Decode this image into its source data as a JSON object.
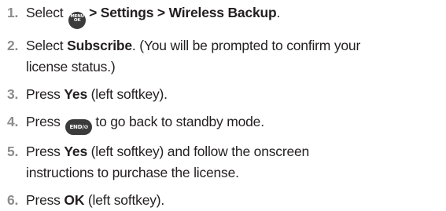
{
  "steps": [
    {
      "number": "1.",
      "parts": [
        {
          "text": "Select",
          "bold": false
        },
        {
          "icon": "menu-ok-key-icon",
          "key_text": [
            "MENU",
            "OK"
          ]
        },
        {
          "text": "> Settings > Wireless Backup",
          "bold": true
        },
        {
          "text": ".",
          "bold": false
        }
      ]
    },
    {
      "number": "2.",
      "line1": [
        {
          "text": "Select ",
          "bold": false
        },
        {
          "text": "Subscribe",
          "bold": true
        },
        {
          "text": ". (You will be prompted to confirm your",
          "bold": false
        }
      ],
      "line2": "license status.)"
    },
    {
      "number": "3.",
      "pre": "Press ",
      "bold": "Yes",
      "post": " (left softkey)."
    },
    {
      "number": "4.",
      "pre": "Press",
      "key_icon": "end-key-icon",
      "key_text": "END/⊘",
      "post": "to go back to standby mode."
    },
    {
      "number": "5.",
      "pre": "Press ",
      "bold": "Yes",
      "post": " (left softkey) and follow the onscreen",
      "line2": "instructions to purchase the license."
    },
    {
      "number": "6.",
      "pre": "Press ",
      "bold": "OK",
      "post": " (left softkey)."
    }
  ]
}
